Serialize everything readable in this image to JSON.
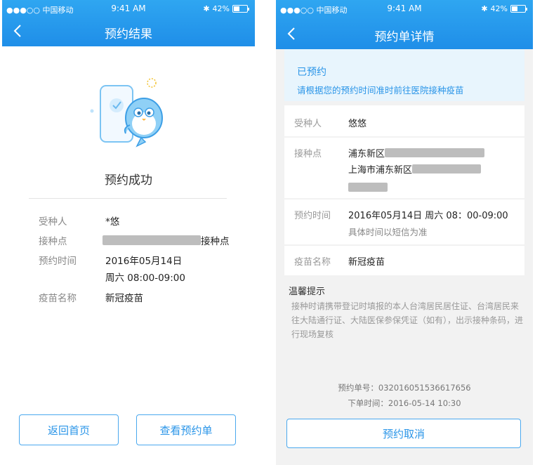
{
  "status_bar": {
    "carrier": "●●●○○ 中国移动",
    "time": "9:41 AM",
    "battery": "42%"
  },
  "left": {
    "nav_title": "预约结果",
    "success_text": "预约成功",
    "rows": {
      "recipient_label": "受种人",
      "recipient_value": "*悠",
      "site_label": "接种点",
      "site_suffix": "接种点",
      "time_label": "预约时间",
      "time_value_date": "2016年05月14日",
      "time_value_slot": "周六  08:00-09:00",
      "vaccine_label": "疫苗名称",
      "vaccine_value": "新冠疫苗"
    },
    "buttons": {
      "home": "返回首页",
      "view_order": "查看预约单"
    }
  },
  "right": {
    "nav_title": "预约单详情",
    "banner": {
      "status": "已预约",
      "message": "请根据您的预约时间准时前往医院接种疫苗"
    },
    "rows": {
      "recipient_label": "受种人",
      "recipient_value": "悠悠",
      "site_label": "接种点",
      "site_line1": "浦东新区",
      "site_line2": "上海市浦东新区",
      "time_label": "预约时间",
      "time_value": "2016年05月14日 周六 08：00-09:00",
      "time_note": "具体时间以短信为准",
      "vaccine_label": "疫苗名称",
      "vaccine_value": "新冠疫苗"
    },
    "tips": {
      "title": "温馨提示",
      "text": "接种时请携带登记时填报的本人台湾居民居住证、台湾居民来往大陆通行证、大陆医保参保凭证（如有），出示接种条码，进行现场复核"
    },
    "order_no": "预约单号：032016051536617656",
    "order_time": "下单时间：2016-05-14 10:30",
    "cancel_button": "预约取消"
  },
  "colors": {
    "primary": "#2a95e8",
    "nav_bg": "#2fa6f1",
    "banner_bg": "#e8f5fd"
  }
}
